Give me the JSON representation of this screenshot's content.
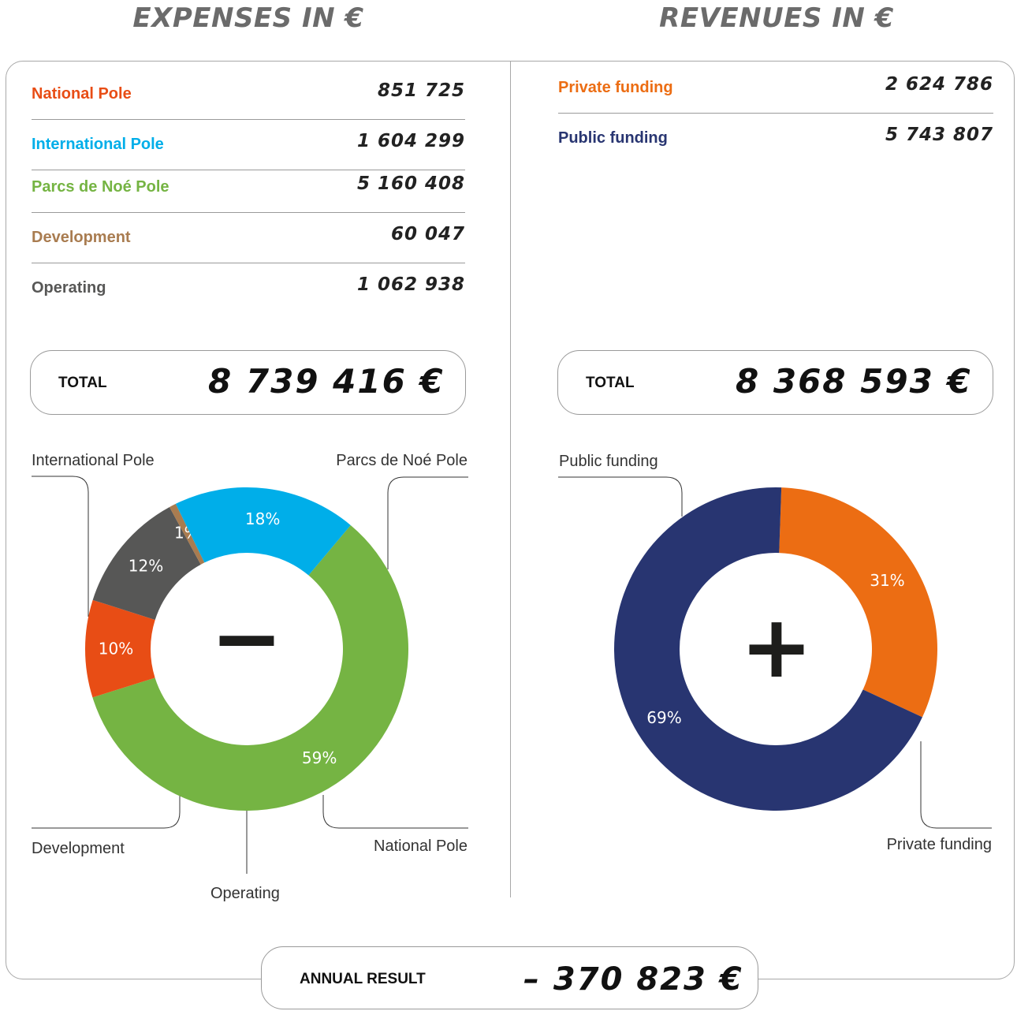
{
  "expenses": {
    "heading": "EXPENSES IN €",
    "rows": [
      {
        "label": "National Pole",
        "value": "851 725",
        "color": "#e84d15"
      },
      {
        "label": "International Pole",
        "value": "1 604 299",
        "color": "#00aee9"
      },
      {
        "label": "Parcs de Noé Pole",
        "value": "5 160 408",
        "color": "#75b443"
      },
      {
        "label": "Development",
        "value": "60 047",
        "color": "#a97c50"
      },
      {
        "label": "Operating",
        "value": "1 062 938",
        "color": "#575756"
      }
    ],
    "total_label": "TOTAL",
    "total_value": "8 739 416 €",
    "center_symbol": "−"
  },
  "revenues": {
    "heading": "REVENUES IN €",
    "rows": [
      {
        "label": "Private funding",
        "value": "2 624 786",
        "color": "#ec6d13"
      },
      {
        "label": "Public funding",
        "value": "5 743 807",
        "color": "#283571"
      }
    ],
    "total_label": "TOTAL",
    "total_value": "8 368 593 €",
    "center_symbol": "+"
  },
  "annual_result": {
    "label": "ANNUAL RESULT",
    "value": "– 370 823 €"
  },
  "chart_data": [
    {
      "type": "pie",
      "donut": true,
      "categories": [
        "Parcs de Noé Pole",
        "National Pole",
        "Operating",
        "Development",
        "International Pole"
      ],
      "values": [
        5160408,
        851725,
        1062938,
        60047,
        1604299
      ],
      "data_labels": [
        "59%",
        "10%",
        "12%",
        "1%",
        "18%"
      ],
      "colors": [
        "#75b443",
        "#e84d15",
        "#575756",
        "#a97c50",
        "#00aee9"
      ]
    },
    {
      "type": "pie",
      "donut": true,
      "categories": [
        "Private funding",
        "Public funding"
      ],
      "values": [
        2624786,
        5743807
      ],
      "data_labels": [
        "31%",
        "69%"
      ],
      "colors": [
        "#ec6d13",
        "#283571"
      ]
    }
  ]
}
